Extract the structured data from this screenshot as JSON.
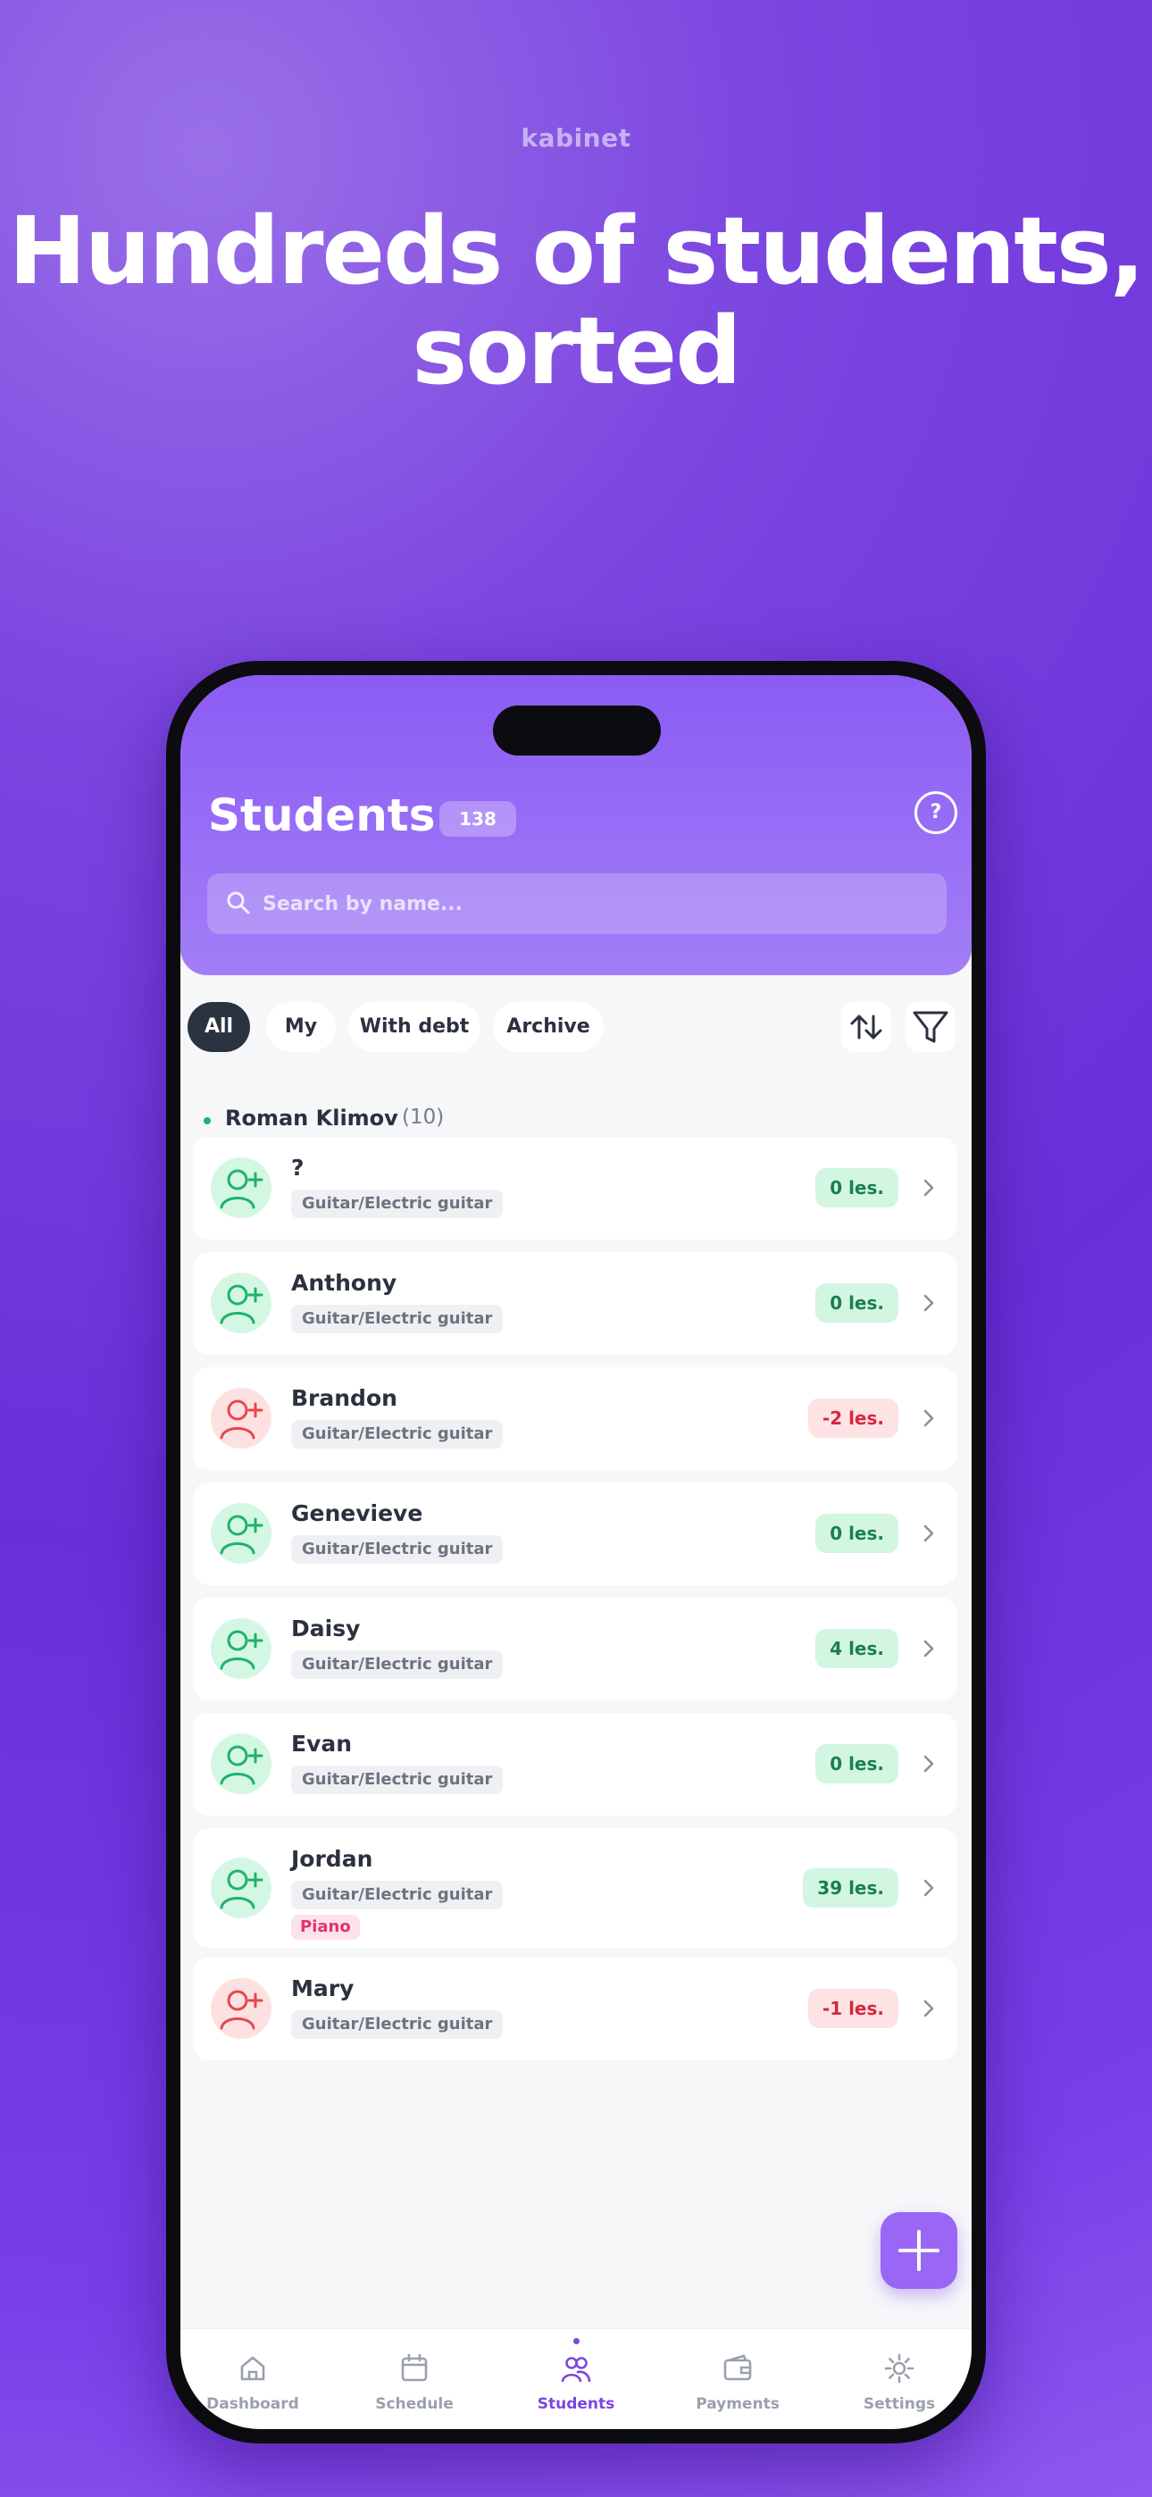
{
  "brand": "kabinet",
  "headline": {
    "line1": "Hundreds of students,",
    "line2": "sorted"
  },
  "header": {
    "title": "Students",
    "count": "138",
    "help_label": "?"
  },
  "search": {
    "placeholder": "Search by name..."
  },
  "filters": {
    "tabs": [
      "All",
      "My",
      "With debt",
      "Archive"
    ],
    "active": "All"
  },
  "group": {
    "name": "Roman Klimov",
    "count": "(10)"
  },
  "students": [
    {
      "name": "?",
      "tags": [
        "Guitar/Electric guitar"
      ],
      "lessons": "0 les.",
      "status": "ok"
    },
    {
      "name": "Anthony",
      "tags": [
        "Guitar/Electric guitar"
      ],
      "lessons": "0 les.",
      "status": "ok"
    },
    {
      "name": "Brandon",
      "tags": [
        "Guitar/Electric guitar"
      ],
      "lessons": "-2 les.",
      "status": "debt"
    },
    {
      "name": "Genevieve",
      "tags": [
        "Guitar/Electric guitar"
      ],
      "lessons": "0 les.",
      "status": "ok"
    },
    {
      "name": "Daisy",
      "tags": [
        "Guitar/Electric guitar"
      ],
      "lessons": "4 les.",
      "status": "ok"
    },
    {
      "name": "Evan",
      "tags": [
        "Guitar/Electric guitar"
      ],
      "lessons": "0 les.",
      "status": "ok"
    },
    {
      "name": "Jordan",
      "tags": [
        "Guitar/Electric guitar",
        "Piano"
      ],
      "lessons": "39 les.",
      "status": "ok"
    },
    {
      "name": "Mary",
      "tags": [
        "Guitar/Electric guitar"
      ],
      "lessons": "-1 les.",
      "status": "debt"
    }
  ],
  "nav": [
    {
      "label": "Dashboard",
      "icon": "home-icon"
    },
    {
      "label": "Schedule",
      "icon": "calendar-icon"
    },
    {
      "label": "Students",
      "icon": "students-icon",
      "active": true
    },
    {
      "label": "Payments",
      "icon": "wallet-icon"
    },
    {
      "label": "Settings",
      "icon": "gear-icon"
    }
  ],
  "colors": {
    "accent": "#7c46e0",
    "ok_bg": "#d2f6e2",
    "ok_text": "#1a7f4c",
    "debt_bg": "#fde3e3",
    "debt_text": "#d8263e"
  }
}
